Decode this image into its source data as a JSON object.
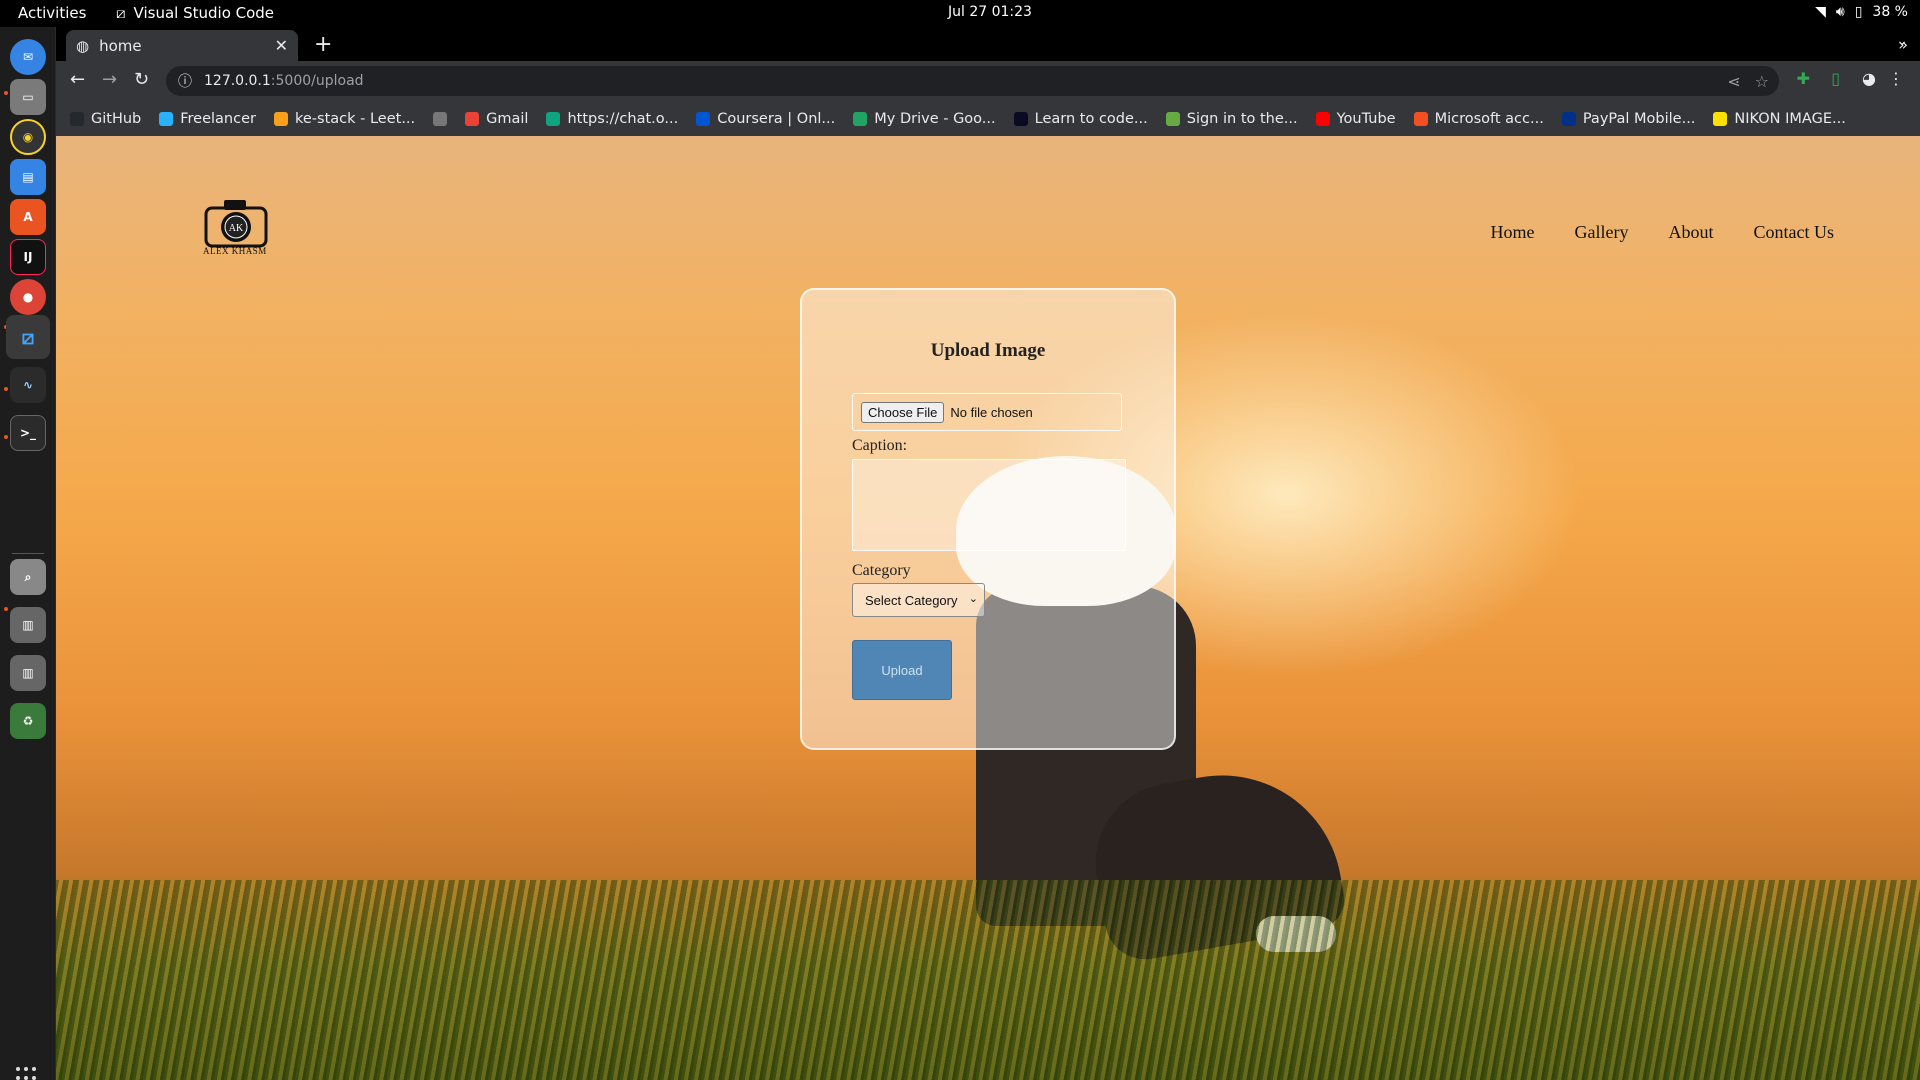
{
  "topbar": {
    "activities": "Activities",
    "app_name": "Visual Studio Code",
    "clock": "Jul 27  01:23",
    "battery": "38 %"
  },
  "browser": {
    "tab_title": "home",
    "url_host": "127.0.0.1",
    "url_path": ":5000/upload",
    "bookmarks": [
      {
        "label": "GitHub",
        "icon": "github-icon"
      },
      {
        "label": "Freelancer",
        "icon": "freelancer-icon"
      },
      {
        "label": "ke-stack - Leet...",
        "icon": "leetcode-icon"
      },
      {
        "label": "",
        "icon": "globe-icon"
      },
      {
        "label": "Gmail",
        "icon": "gmail-icon"
      },
      {
        "label": "https://chat.o...",
        "icon": "chatgpt-icon"
      },
      {
        "label": "Coursera | Onl...",
        "icon": "coursera-icon"
      },
      {
        "label": "My Drive - Goo...",
        "icon": "drive-icon"
      },
      {
        "label": "Learn to code...",
        "icon": "freecodecamp-icon"
      },
      {
        "label": "Sign in to the...",
        "icon": "signin-icon"
      },
      {
        "label": "YouTube",
        "icon": "youtube-icon"
      },
      {
        "label": "Microsoft acc...",
        "icon": "microsoft-icon"
      },
      {
        "label": "PayPal Mobile...",
        "icon": "paypal-icon"
      },
      {
        "label": "NIKON IMAGE...",
        "icon": "nikon-icon"
      }
    ]
  },
  "site": {
    "logo_initials": "AK",
    "logo_text": "ALEX KHASM",
    "nav": [
      "Home",
      "Gallery",
      "About",
      "Contact Us"
    ]
  },
  "form": {
    "title": "Upload Image",
    "choose_file": "Choose File",
    "no_file": "No file chosen",
    "caption_label": "Caption:",
    "category_label": "Category",
    "category_selected": "Select Category",
    "upload_button": "Upload"
  },
  "colors": {
    "upload_button": "#4f86b6",
    "accent_tab_new": "#8ab4f8"
  }
}
